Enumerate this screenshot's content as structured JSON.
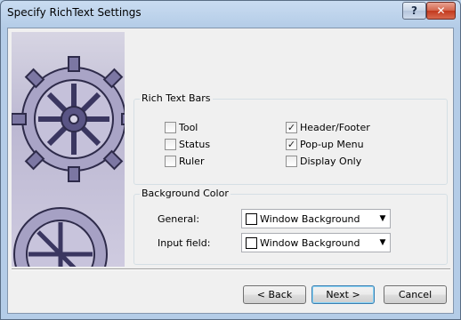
{
  "window": {
    "title": "Specify RichText Settings",
    "help_label": "?",
    "close_label": "✕"
  },
  "rich_text_bars": {
    "legend": "Rich Text Bars",
    "options": [
      {
        "label": "Tool",
        "checked": false
      },
      {
        "label": "Status",
        "checked": false
      },
      {
        "label": "Ruler",
        "checked": false
      },
      {
        "label": "Header/Footer",
        "checked": true
      },
      {
        "label": "Pop-up Menu",
        "checked": true
      },
      {
        "label": "Display Only",
        "checked": false
      }
    ]
  },
  "background_color": {
    "legend": "Background Color",
    "general_label": "General:",
    "general_value": "Window Background",
    "input_label": "Input field:",
    "input_value": "Window Background"
  },
  "buttons": {
    "back": "< Back",
    "next": "Next >",
    "cancel": "Cancel"
  },
  "colors": {
    "accent": "#3c7fb1",
    "gear": "#4a4670"
  }
}
